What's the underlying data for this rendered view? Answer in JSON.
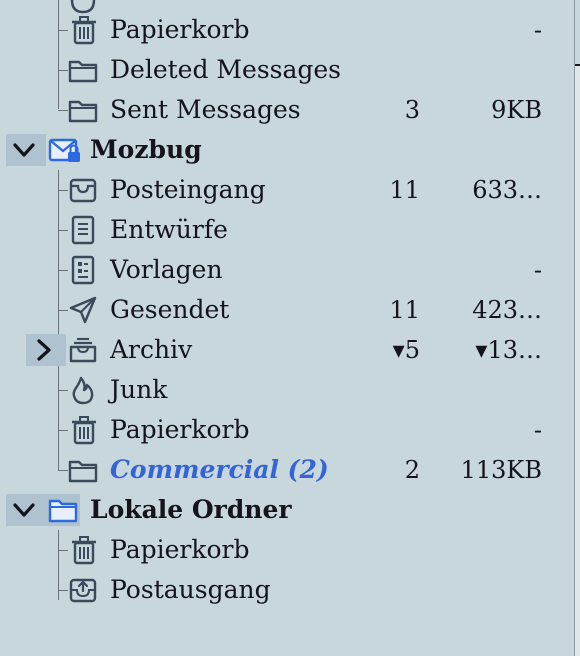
{
  "colors": {
    "background": "#c7d7db",
    "accent": "#3464d8",
    "icon": "#3a4a5c",
    "selection": "#aec3cf"
  },
  "rows": [
    {
      "label": "Papierkorb",
      "icon": "trash-icon",
      "count": "",
      "size": "-"
    },
    {
      "label": "Deleted Messages",
      "icon": "folder-icon",
      "count": "",
      "size": ""
    },
    {
      "label": "Sent Messages",
      "icon": "folder-icon",
      "count": "3",
      "size": "9KB"
    },
    {
      "label": "Mozbug",
      "icon": "mail-account-icon",
      "count": "",
      "size": ""
    },
    {
      "label": "Posteingang",
      "icon": "inbox-icon",
      "count": "11",
      "size": "633…"
    },
    {
      "label": "Entwürfe",
      "icon": "drafts-icon",
      "count": "",
      "size": ""
    },
    {
      "label": "Vorlagen",
      "icon": "templates-icon",
      "count": "",
      "size": "-"
    },
    {
      "label": "Gesendet",
      "icon": "sent-icon",
      "count": "11",
      "size": "423…"
    },
    {
      "label": "Archiv",
      "icon": "archive-icon",
      "count": "▾5",
      "size": "▾13…"
    },
    {
      "label": "Junk",
      "icon": "junk-icon",
      "count": "",
      "size": ""
    },
    {
      "label": "Papierkorb",
      "icon": "trash-icon",
      "count": "",
      "size": "-"
    },
    {
      "label": "Commercial (2)",
      "icon": "folder-icon",
      "count": "2",
      "size": "113KB"
    },
    {
      "label": "Lokale Ordner",
      "icon": "local-folders-icon",
      "count": "",
      "size": ""
    },
    {
      "label": "Papierkorb",
      "icon": "trash-icon",
      "count": "",
      "size": ""
    },
    {
      "label": "Postausgang",
      "icon": "outbox-icon",
      "count": "",
      "size": ""
    }
  ]
}
